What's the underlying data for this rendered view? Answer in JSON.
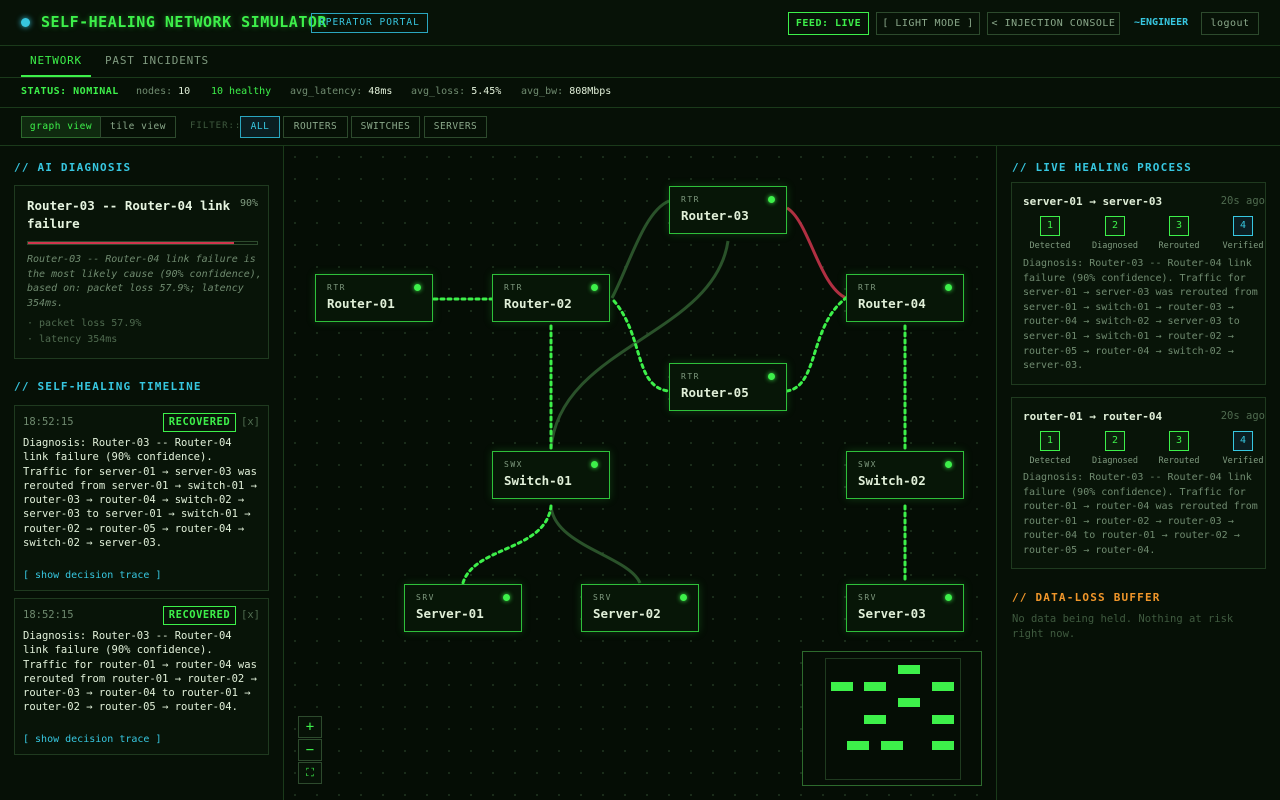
{
  "header": {
    "title": "SELF-HEALING NETWORK SIMULATOR",
    "portal_badge": "OPERATOR PORTAL",
    "feed": "FEED: LIVE",
    "light_mode": "[ LIGHT MODE ]",
    "injection": "< INJECTION CONSOLE",
    "user": "~ENGINEER",
    "logout": "logout",
    "status_dot_icon": "status-dot-icon"
  },
  "tabs": [
    {
      "label": "NETWORK",
      "active": true
    },
    {
      "label": "PAST INCIDENTS",
      "active": false
    }
  ],
  "status": {
    "status_label": "STATUS: NOMINAL",
    "nodes_label": "nodes:",
    "nodes_value": "10",
    "healthy": "10 healthy",
    "latency_label": "avg_latency:",
    "latency_value": "48ms",
    "loss_label": "avg_loss:",
    "loss_value": "5.45%",
    "bw_label": "avg_bw:",
    "bw_value": "808Mbps"
  },
  "toolbar": {
    "graph_view": "graph view",
    "tile_view": "tile view",
    "filter_label": "FILTER::",
    "filters": [
      "ALL",
      "ROUTERS",
      "SWITCHES",
      "SERVERS"
    ]
  },
  "diagnosis": {
    "section_title": "// AI DIAGNOSIS",
    "title": "Router-03 -- Router-04 link failure",
    "confidence": "90%",
    "confidence_value": 0.9,
    "description": "Router-03 -- Router-04 link failure is the most likely cause (90% confidence), based on: packet loss 57.9%; latency 354ms.",
    "evidence": [
      "· packet loss 57.9%",
      "· latency 354ms"
    ]
  },
  "timeline": {
    "section_title": "// SELF-HEALING TIMELINE",
    "entries": [
      {
        "time": "18:52:15",
        "badge": "RECOVERED",
        "close": "[x]",
        "text": "Diagnosis: Router-03 -- Router-04 link failure (90% confidence). Traffic for server-01 → server-03 was rerouted from server-01 → switch-01 → router-03 → router-04 → switch-02 → server-03 to server-01 → switch-01 → router-02 → router-05 → router-04 → switch-02 → server-03.",
        "link": "[ show decision trace ]"
      },
      {
        "time": "18:52:15",
        "badge": "RECOVERED",
        "close": "[x]",
        "text": "Diagnosis: Router-03 -- Router-04 link failure (90% confidence). Traffic for router-01 → router-04 was rerouted from router-01 → router-02 → router-03 → router-04 to router-01 → router-02 → router-05 → router-04.",
        "link": "[ show decision trace ]"
      }
    ]
  },
  "graph": {
    "nodes": [
      {
        "id": "router-01",
        "type": "RTR",
        "name": "Router-01"
      },
      {
        "id": "router-02",
        "type": "RTR",
        "name": "Router-02"
      },
      {
        "id": "router-03",
        "type": "RTR",
        "name": "Router-03"
      },
      {
        "id": "router-04",
        "type": "RTR",
        "name": "Router-04"
      },
      {
        "id": "router-05",
        "type": "RTR",
        "name": "Router-05"
      },
      {
        "id": "switch-01",
        "type": "SWX",
        "name": "Switch-01"
      },
      {
        "id": "switch-02",
        "type": "SWX",
        "name": "Switch-02"
      },
      {
        "id": "server-01",
        "type": "SRV",
        "name": "Server-01"
      },
      {
        "id": "server-02",
        "type": "SRV",
        "name": "Server-02"
      },
      {
        "id": "server-03",
        "type": "SRV",
        "name": "Server-03"
      }
    ],
    "zoom_in": "+",
    "zoom_out": "−",
    "fit": "⛶",
    "colors": {
      "active_link": "#3df04a",
      "failed_link": "#d0364e",
      "idle_link": "#2f5a2f"
    }
  },
  "healing": {
    "section_title": "// LIVE HEALING PROCESS",
    "steps": [
      "Detected",
      "Diagnosed",
      "Rerouted",
      "Verified"
    ],
    "cards": [
      {
        "route": "server-01 → server-03",
        "ago": "20s ago",
        "text": "Diagnosis: Router-03 -- Router-04 link failure (90% confidence). Traffic for server-01 → server-03 was rerouted from server-01 → switch-01 → router-03 → router-04 → switch-02 → server-03 to server-01 → switch-01 → router-02 → router-05 → router-04 → switch-02 → server-03."
      },
      {
        "route": "router-01 → router-04",
        "ago": "20s ago",
        "text": "Diagnosis: Router-03 -- Router-04 link failure (90% confidence). Traffic for router-01 → router-04 was rerouted from router-01 → router-02 → router-03 → router-04 to router-01 → router-02 → router-05 → router-04."
      }
    ]
  },
  "buffer": {
    "section_title": "// DATA-LOSS BUFFER",
    "text": "No data being held. Nothing at risk right now."
  }
}
